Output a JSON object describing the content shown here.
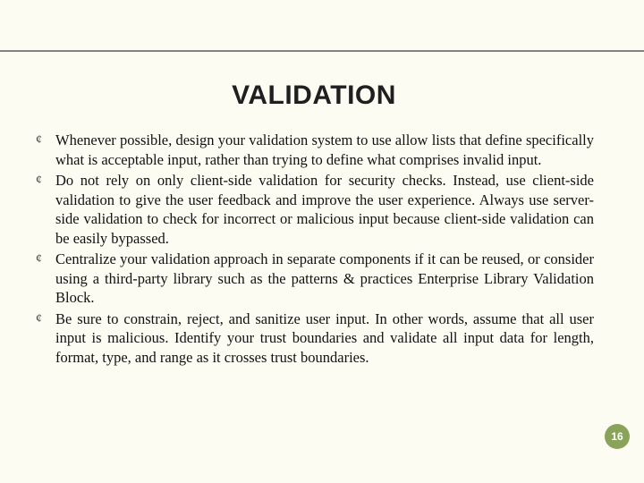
{
  "title": "VALIDATION",
  "bullets": [
    "Whenever possible, design your validation system to use allow lists that define specifically what is acceptable input, rather than trying to define what comprises invalid input.",
    "Do not rely on only client-side validation for security checks. Instead, use client-side validation to give the user feedback and improve the user experience. Always use server-side validation to check for incorrect or malicious input because client-side validation can be easily bypassed.",
    "Centralize your validation approach in separate components if it can be reused, or consider using a third-party library such as the patterns & practices Enterprise Library Validation Block.",
    "Be sure to constrain, reject, and sanitize user input. In other words, assume that all user input is malicious. Identify your trust boundaries and validate all input data for length, format, type, and range as it crosses trust boundaries."
  ],
  "bullet_glyph": "¢",
  "page_number": "16"
}
